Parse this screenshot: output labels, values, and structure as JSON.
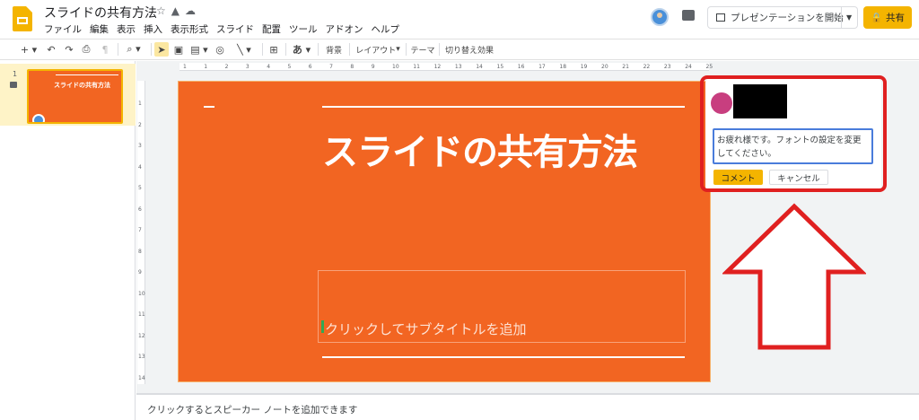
{
  "app": {
    "title": "スライドの共有方法",
    "menu": [
      "ファイル",
      "編集",
      "表示",
      "挿入",
      "表示形式",
      "スライド",
      "配置",
      "ツール",
      "アドオン",
      "ヘルプ"
    ],
    "present_label": "プレゼンテーションを開始",
    "share_label": "共有"
  },
  "toolbar": {
    "background_label": "背景",
    "layout_label": "レイアウト",
    "theme_label": "テーマ",
    "transition_label": "切り替え効果",
    "text_label": "あ"
  },
  "filmstrip": {
    "slides": [
      {
        "number": "1",
        "thumb_title": "スライドの共有方法"
      }
    ]
  },
  "ruler": {
    "top_ticks": [
      "1",
      "1",
      "2",
      "3",
      "4",
      "5",
      "6",
      "7",
      "8",
      "9",
      "10",
      "11",
      "12",
      "13",
      "14",
      "15",
      "16",
      "17",
      "18",
      "19",
      "20",
      "21",
      "22",
      "23",
      "24",
      "25"
    ],
    "left_ticks": [
      "1",
      "2",
      "3",
      "4",
      "5",
      "6",
      "7",
      "8",
      "9",
      "10",
      "11",
      "12",
      "13",
      "14"
    ]
  },
  "slide": {
    "title": "スライドの共有方法",
    "subtitle_placeholder": "クリックしてサブタイトルを追加"
  },
  "notes": {
    "placeholder": "クリックするとスピーカー ノートを追加できます"
  },
  "comment": {
    "text": "お疲れ様です。フォントの設定を変更してください。",
    "submit_label": "コメント",
    "cancel_label": "キャンセル"
  },
  "colors": {
    "slide_bg": "#f26522",
    "accent": "#f4b400",
    "annotation": "#e02020"
  }
}
